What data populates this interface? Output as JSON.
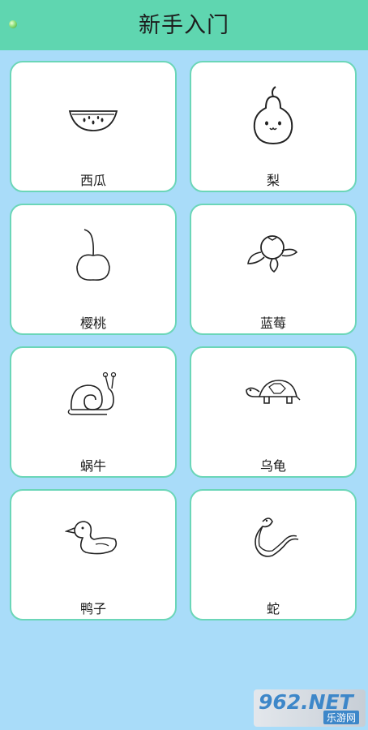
{
  "header": {
    "title": "新手入门",
    "back_icon": "green-dot-back-icon"
  },
  "cards": [
    {
      "label": "西瓜",
      "icon": "watermelon-icon"
    },
    {
      "label": "梨",
      "icon": "pear-icon"
    },
    {
      "label": "樱桃",
      "icon": "cherry-icon"
    },
    {
      "label": "蓝莓",
      "icon": "blueberry-icon"
    },
    {
      "label": "蜗牛",
      "icon": "snail-icon"
    },
    {
      "label": "乌龟",
      "icon": "turtle-icon"
    },
    {
      "label": "鸭子",
      "icon": "duck-icon"
    },
    {
      "label": "蛇",
      "icon": "snake-icon"
    }
  ],
  "watermark": {
    "brand": "962.NET",
    "sub": "乐游网"
  },
  "colors": {
    "header": "#5fd6b0",
    "background": "#a9dcf9",
    "card_border": "#6bd6b8"
  }
}
